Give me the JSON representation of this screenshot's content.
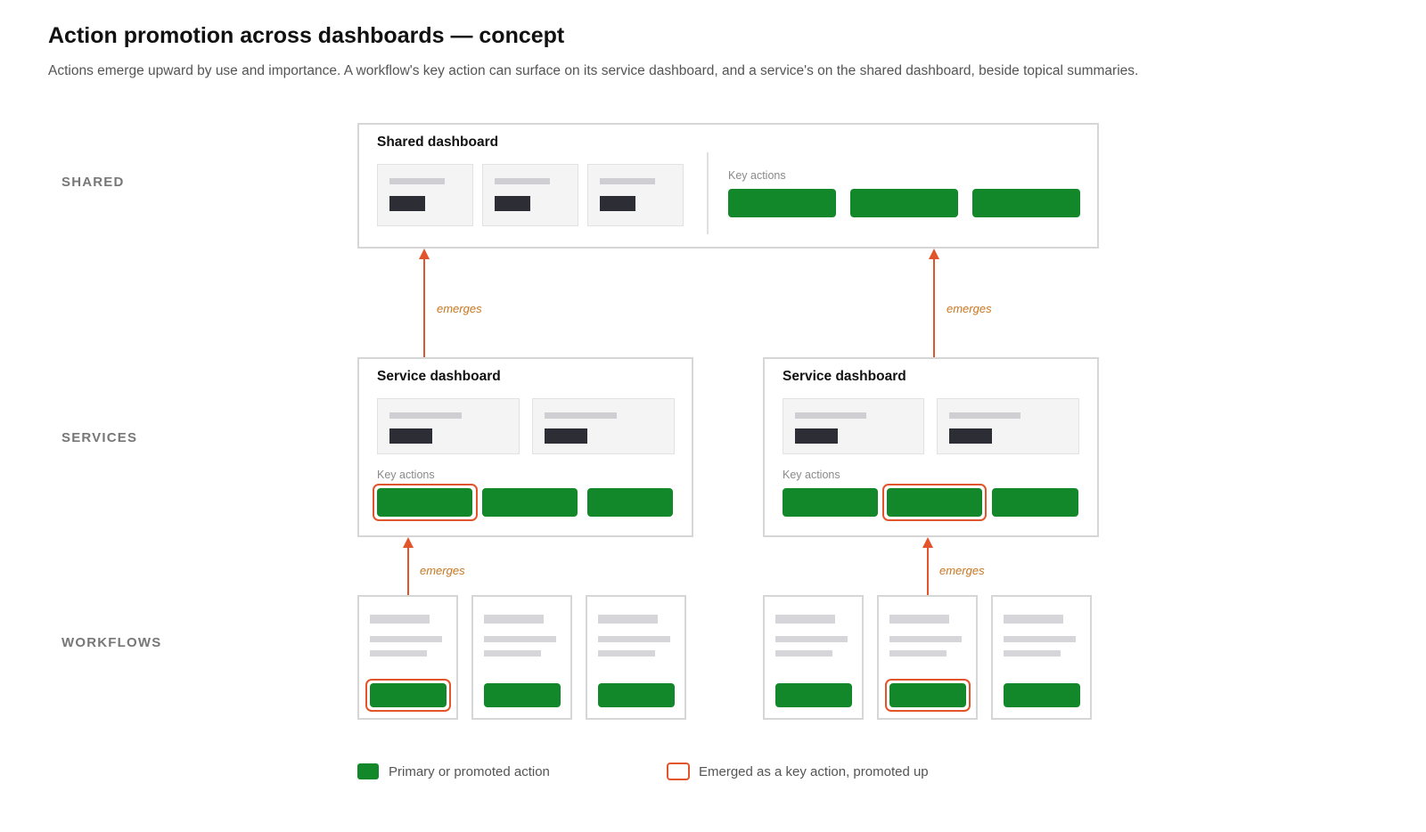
{
  "header": {
    "title": "Action promotion across dashboards — concept",
    "subtitle": "Actions emerge upward by use and importance. A workflow's key action can surface on its service dashboard, and a service's on the shared dashboard, beside topical summaries."
  },
  "rows": {
    "shared": "SHARED",
    "services": "SERVICES",
    "workflows": "WORKFLOWS"
  },
  "shared_dashboard": {
    "title": "Shared dashboard",
    "key_actions_label": "Key actions",
    "summaries": 3,
    "actions": 3
  },
  "service_dashboards": [
    {
      "title": "Service dashboard",
      "key_actions_label": "Key actions",
      "summaries": 2,
      "actions": 3,
      "promoted_action_index": 0
    },
    {
      "title": "Service dashboard",
      "key_actions_label": "Key actions",
      "summaries": 2,
      "actions": 3,
      "promoted_action_index": 1
    }
  ],
  "workflow_groups": [
    {
      "count": 3,
      "promoted_workflow_index": 0
    },
    {
      "count": 3,
      "promoted_workflow_index": 1
    }
  ],
  "arrows": {
    "label": "emerges"
  },
  "legend": {
    "primary": "Primary or promoted action",
    "emerged": "Emerged as a key action, promoted up"
  },
  "colors": {
    "action_green": "#13882a",
    "promoted_outline": "#e2552b",
    "arrow": "#e2552b",
    "arrow_label": "#c77620",
    "summary_block": "#2d2d35"
  }
}
